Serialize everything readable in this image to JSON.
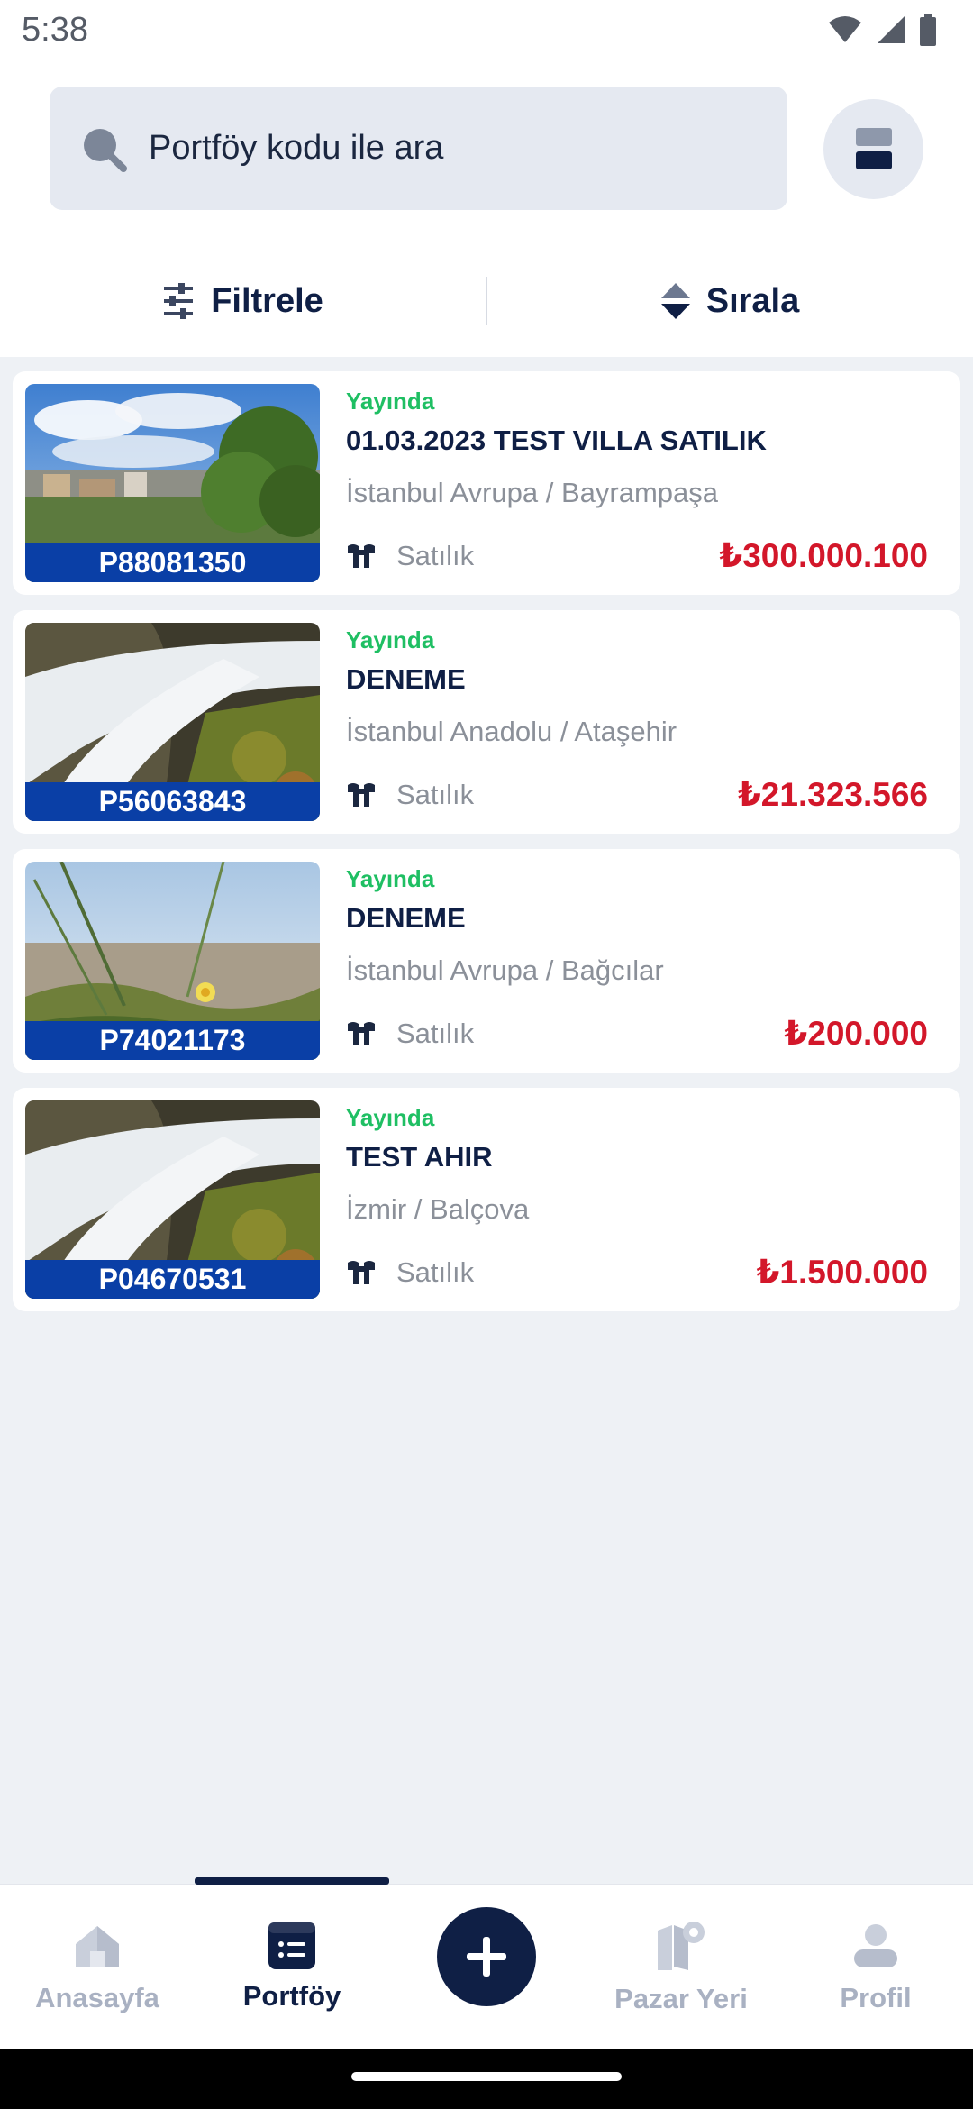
{
  "status_bar": {
    "time": "5:38"
  },
  "search": {
    "placeholder": "Portföy kodu ile ara"
  },
  "actions": {
    "filter_label": "Filtrele",
    "sort_label": "Sırala"
  },
  "listings": [
    {
      "code": "P88081350",
      "status": "Yayında",
      "title": "01.03.2023 TEST VILLA SATILIK",
      "location": "İstanbul Avrupa / Bayrampaşa",
      "type": "Satılık",
      "price": "₺300.000.100"
    },
    {
      "code": "P56063843",
      "status": "Yayında",
      "title": "DENEME",
      "location": "İstanbul Anadolu / Ataşehir",
      "type": "Satılık",
      "price": "₺21.323.566"
    },
    {
      "code": "P74021173",
      "status": "Yayında",
      "title": "DENEME",
      "location": "İstanbul Avrupa / Bağcılar",
      "type": "Satılık",
      "price": "₺200.000"
    },
    {
      "code": "P04670531",
      "status": "Yayında",
      "title": "TEST AHIR",
      "location": "İzmir / Balçova",
      "type": "Satılık",
      "price": "₺1.500.000"
    }
  ],
  "nav": {
    "home": "Anasayfa",
    "portfolio": "Portföy",
    "market": "Pazar Yeri",
    "profile": "Profil"
  },
  "colors": {
    "primary": "#0f1f45",
    "status_green": "#1fbf63",
    "price_red": "#d3172a",
    "code_badge": "#0a3fa6"
  }
}
